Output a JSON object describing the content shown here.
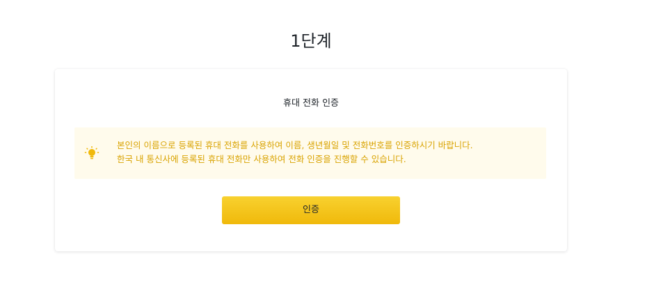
{
  "page": {
    "step_title": "1단계"
  },
  "card": {
    "title": "휴대 전화 인증",
    "notice": {
      "icon": "lightbulb-icon",
      "line1": "본인의 이름으로 등록된 휴대 전화를 사용하여 이름, 생년월일 및 전화번호를 인증하시기 바랍니다.",
      "line2": "한국 내 통신사에 등록된 휴대 전화만 사용하여 전화 인증을 진행할 수 있습니다."
    },
    "button_label": "인증"
  },
  "colors": {
    "accent": "#f0b90b",
    "notice_text": "#d9a300",
    "notice_bg": "#fffbec",
    "text": "#1e2329"
  }
}
